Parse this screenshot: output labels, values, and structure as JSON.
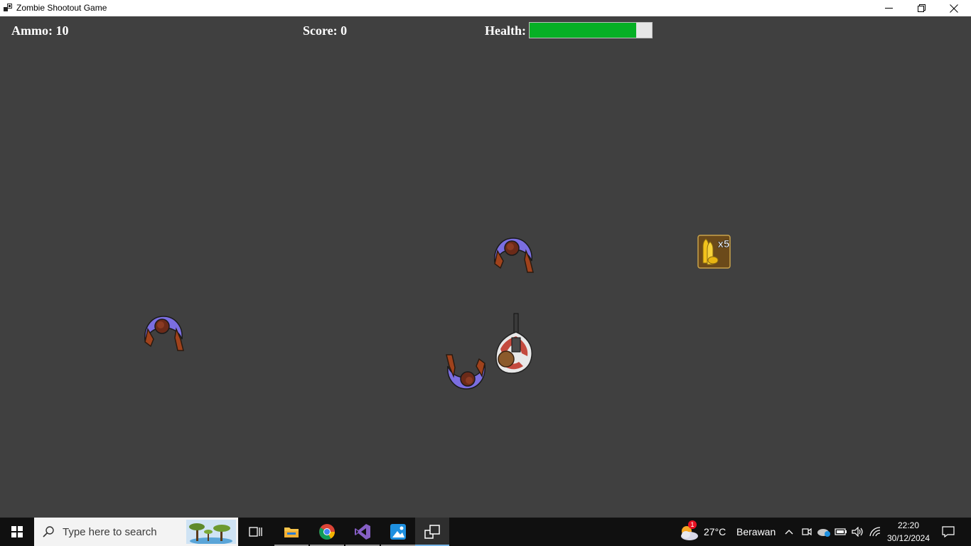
{
  "window": {
    "title": "Zombie Shootout Game"
  },
  "hud": {
    "ammo": "Ammo: 10",
    "score": "Score: 0",
    "health_label": "Health:",
    "health_fraction": 0.87
  },
  "pickup": {
    "label": "x5",
    "icon": "ammo-box-icon"
  },
  "entities": {
    "zombies": [
      "zombie",
      "zombie",
      "zombie"
    ],
    "player": "player"
  },
  "taskbar": {
    "search_placeholder": "Type here to search",
    "weather_temp": "27°C",
    "weather_desc": "Berawan",
    "weather_badge": "1",
    "time": "22:20",
    "date": "30/12/2024"
  },
  "colors": {
    "background": "#404040",
    "health": "#06b025",
    "taskbar": "#101010"
  }
}
